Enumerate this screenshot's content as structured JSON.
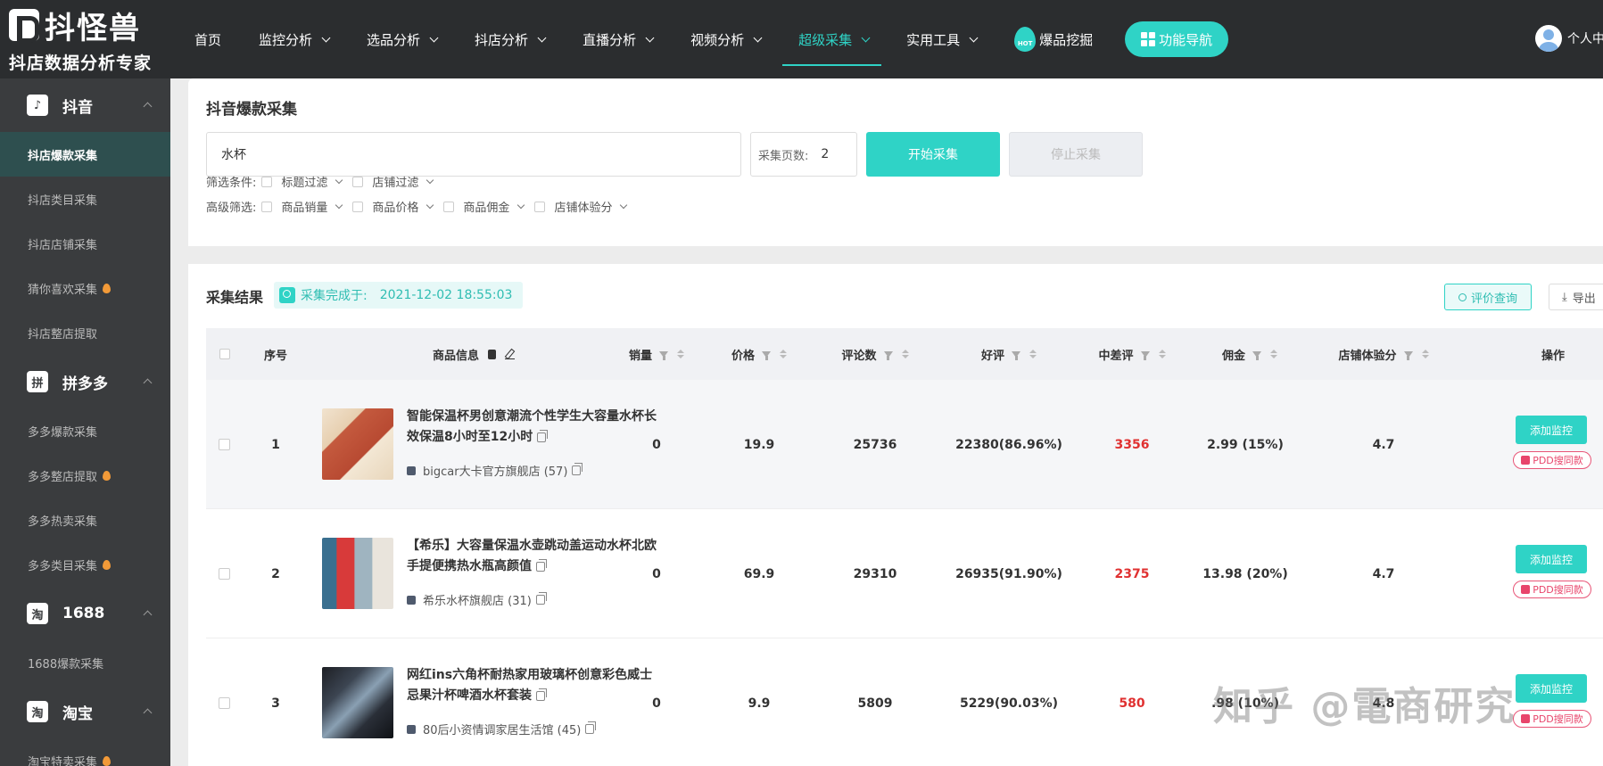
{
  "brand": {
    "title": "抖怪兽",
    "subtitle": "抖店数据分析专家"
  },
  "nav": {
    "items": [
      {
        "label": "首页",
        "has_menu": false,
        "active": false
      },
      {
        "label": "监控分析",
        "has_menu": true,
        "active": false
      },
      {
        "label": "选品分析",
        "has_menu": true,
        "active": false
      },
      {
        "label": "抖店分析",
        "has_menu": true,
        "active": false
      },
      {
        "label": "直播分析",
        "has_menu": true,
        "active": false
      },
      {
        "label": "视频分析",
        "has_menu": true,
        "active": false
      },
      {
        "label": "超级采集",
        "has_menu": true,
        "active": true
      },
      {
        "label": "实用工具",
        "has_menu": true,
        "active": false
      }
    ],
    "hot_badge": "HOT",
    "hot_label": "爆品挖掘",
    "func_nav": "功能导航",
    "user": "个人中"
  },
  "sidebar": {
    "groups": [
      {
        "label": "抖音",
        "icon": "douyin-icon",
        "icon_text": "♪",
        "items": [
          {
            "label": "抖店爆款采集",
            "active": true,
            "hot": false
          },
          {
            "label": "抖店类目采集",
            "active": false,
            "hot": false
          },
          {
            "label": "抖店店铺采集",
            "active": false,
            "hot": false
          },
          {
            "label": "猜你喜欢采集",
            "active": false,
            "hot": true
          },
          {
            "label": "抖店整店提取",
            "active": false,
            "hot": false
          }
        ]
      },
      {
        "label": "拼多多",
        "icon": "pinduoduo-icon",
        "icon_text": "拼",
        "items": [
          {
            "label": "多多爆款采集",
            "active": false,
            "hot": false
          },
          {
            "label": "多多整店提取",
            "active": false,
            "hot": true
          },
          {
            "label": "多多热卖采集",
            "active": false,
            "hot": false
          },
          {
            "label": "多多类目采集",
            "active": false,
            "hot": true
          }
        ]
      },
      {
        "label": "1688",
        "icon": "alibaba-1688-icon",
        "icon_text": "淘",
        "items": [
          {
            "label": "1688爆款采集",
            "active": false,
            "hot": false
          }
        ]
      },
      {
        "label": "淘宝",
        "icon": "taobao-icon",
        "icon_text": "淘",
        "items": [
          {
            "label": "淘宝特卖采集",
            "active": false,
            "hot": true
          }
        ]
      }
    ]
  },
  "collect": {
    "title": "抖音爆款采集",
    "keyword": "水杯",
    "pages_label": "采集页数:",
    "pages_value": "2",
    "start": "开始采集",
    "stop": "停止采集",
    "filter_label": "筛选条件:",
    "filters": [
      "标题过滤",
      "店铺过滤"
    ],
    "adv_label": "高级筛选:",
    "adv_filters": [
      "商品销量",
      "商品价格",
      "商品佣金",
      "店铺体验分"
    ]
  },
  "results": {
    "title": "采集结果",
    "done_label": "采集完成于:",
    "done_time": "2021-12-02 18:55:03",
    "review_btn": "评价查询",
    "export_btn": "导出",
    "columns": {
      "index": "序号",
      "product": "商品信息",
      "sales": "销量",
      "price": "价格",
      "comments": "评论数",
      "good": "好评",
      "bad": "中差评",
      "commission": "佣金",
      "score": "店铺体验分",
      "ops": "操作"
    },
    "add_monitor": "添加监控",
    "pdd_search": "PDD搜同款",
    "rows": [
      {
        "index": "1",
        "name": "智能保温杯男创意潮流个性学生大容量水杯长效保温8小时至12小时",
        "shop": "bigcar大卡官方旗舰店 (57)",
        "sales": "0",
        "price": "19.9",
        "comments": "25736",
        "good": "22380(86.96%)",
        "bad": "3356",
        "commission": "2.99 (15%)",
        "score": "4.7"
      },
      {
        "index": "2",
        "name": "【希乐】大容量保温水壶跳动盖运动水杯北欧手提便携热水瓶高颜值",
        "shop": "希乐水杯旗舰店 (31)",
        "sales": "0",
        "price": "69.9",
        "comments": "29310",
        "good": "26935(91.90%)",
        "bad": "2375",
        "commission": "13.98 (20%)",
        "score": "4.7"
      },
      {
        "index": "3",
        "name": "网红ins六角杯耐热家用玻璃杯创意彩色威士忌果汁杯啤酒水杯套装",
        "shop": "80后小资情调家居生活馆 (45)",
        "sales": "0",
        "price": "9.9",
        "comments": "5809",
        "good": "5229(90.03%)",
        "bad": "580",
        "commission": ".98 (10%)",
        "score": "4.8"
      }
    ]
  },
  "watermark": "知乎 @電商研究",
  "colors": {
    "accent": "#2fd3c6",
    "topbar": "#2b2d2f",
    "sidebar": "#3a3c3e",
    "sidebar_active": "#2e4f4f",
    "negative": "#e03131",
    "pdd": "#e8456b"
  }
}
